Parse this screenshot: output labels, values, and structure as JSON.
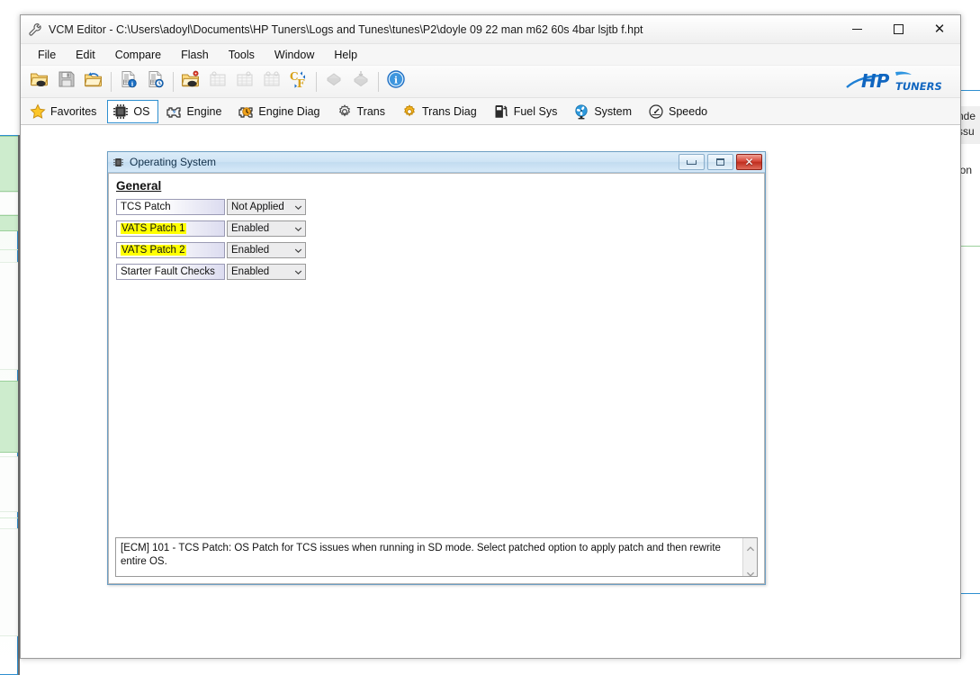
{
  "window": {
    "title": "VCM Editor - C:\\Users\\adoyl\\Documents\\HP Tuners\\Logs and Tunes\\tunes\\P2\\doyle 09 22 man m62 60s 4bar lsjtb f.hpt",
    "title_icon": "wrench-icon",
    "controls": {
      "minimize": "minimize-icon",
      "maximize": "maximize-icon",
      "close": "close-icon"
    }
  },
  "menubar": {
    "items": [
      {
        "label": "File"
      },
      {
        "label": "Edit"
      },
      {
        "label": "Compare"
      },
      {
        "label": "Flash"
      },
      {
        "label": "Tools"
      },
      {
        "label": "Window"
      },
      {
        "label": "Help"
      }
    ]
  },
  "toolbar": {
    "buttons": [
      {
        "icon": "open-folder-icon",
        "enabled": true
      },
      {
        "icon": "save-disk-icon",
        "enabled": true
      },
      {
        "icon": "folder-undo-icon",
        "enabled": true
      },
      {
        "sep": true
      },
      {
        "icon": "document-info-icon",
        "enabled": true
      },
      {
        "icon": "document-history-icon",
        "enabled": true
      },
      {
        "sep": true
      },
      {
        "icon": "folder-settings-icon",
        "enabled": true
      },
      {
        "icon": "table-icon-1",
        "enabled": false
      },
      {
        "icon": "table-icon-2",
        "enabled": false
      },
      {
        "icon": "table-icon-3",
        "enabled": false
      },
      {
        "icon": "celsius-fahrenheit-icon",
        "enabled": true
      },
      {
        "sep": true
      },
      {
        "icon": "chip-read-icon",
        "enabled": false
      },
      {
        "icon": "chip-write-icon",
        "enabled": false
      },
      {
        "sep": true
      },
      {
        "icon": "info-circle-icon",
        "enabled": true
      }
    ],
    "logo_text_primary": "HP",
    "logo_text_secondary": "TUNERS",
    "logo_color": "#1e7fd4"
  },
  "tabs": {
    "selected": "OS",
    "accent_color": "#2e8fd0",
    "items": [
      {
        "label": "Favorites",
        "icon": "star-icon"
      },
      {
        "label": "OS",
        "icon": "chip-icon"
      },
      {
        "label": "Engine",
        "icon": "engine-icon"
      },
      {
        "label": "Engine Diag",
        "icon": "engine-diag-icon"
      },
      {
        "label": "Trans",
        "icon": "gear-icon"
      },
      {
        "label": "Trans Diag",
        "icon": "gear-orange-icon"
      },
      {
        "label": "Fuel Sys",
        "icon": "fuel-pump-icon"
      },
      {
        "label": "System",
        "icon": "fan-icon"
      },
      {
        "label": "Speedo",
        "icon": "speedometer-icon"
      }
    ]
  },
  "os_window": {
    "title": "Operating System",
    "title_icon": "chip-icon",
    "controls": {
      "minimize": "minimize-icon",
      "restore": "restore-icon",
      "close": "close-icon"
    },
    "section_title": "General",
    "parameters": [
      {
        "label": "TCS Patch",
        "highlighted": false,
        "value": "Not Applied"
      },
      {
        "label": "VATS Patch 1",
        "highlighted": true,
        "value": "Enabled"
      },
      {
        "label": "VATS Patch 2",
        "highlighted": true,
        "value": "Enabled"
      },
      {
        "label": "Starter Fault Checks",
        "highlighted": false,
        "value": "Enabled"
      }
    ],
    "highlight_color": "#ffff00",
    "status_text": "[ECM] 101 - TCS Patch: OS Patch for TCS issues when running in SD mode. Select patched option to apply patch and then rewrite entire OS.",
    "scroll_up_icon": "chevron-up-icon",
    "scroll_down_icon": "chevron-down-icon"
  },
  "background": {
    "right_snippet_line1": "nde",
    "right_snippet_line2": "ssu",
    "right_snippet_line3": "ion"
  }
}
